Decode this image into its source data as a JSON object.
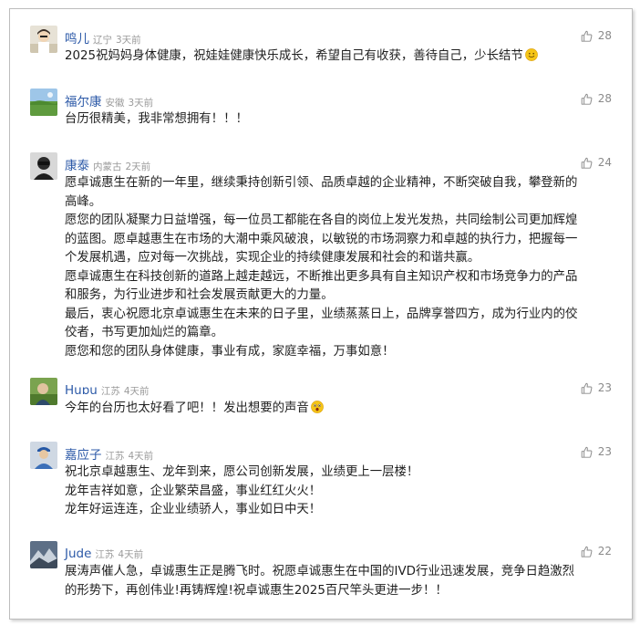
{
  "comments": [
    {
      "name": "鸣儿",
      "location": "辽宁",
      "time": "3天前",
      "likes": "28",
      "avatar": "avatar-person-light",
      "lines": [
        "2025祝妈妈身体健康，祝娃娃健康快乐成长，希望自己有收获，善待自己，少长结节"
      ],
      "emoji": "smiling-face-emoji"
    },
    {
      "name": "福尔康",
      "location": "安徽",
      "time": "3天前",
      "likes": "28",
      "avatar": "avatar-landscape",
      "lines": [
        "台历很精美，我非常想拥有！！！"
      ]
    },
    {
      "name": "康泰",
      "location": "内蒙古",
      "time": "2天前",
      "likes": "24",
      "avatar": "avatar-person-dark",
      "lines": [
        "愿卓诚惠生在新的一年里，继续秉持创新引领、品质卓越的企业精神，不断突破自我，攀登新的",
        "高峰。",
        "愿您的团队凝聚力日益增强，每一位员工都能在各自的岗位上发光发热，共同绘制公司更加辉煌",
        "的蓝图。愿卓越惠生在市场的大潮中乘风破浪，以敏锐的市场洞察力和卓越的执行力，把握每一",
        "个发展机遇，应对每一次挑战，实现企业的持续健康发展和社会的和谐共赢。",
        "愿卓诚惠生在科技创新的道路上越走越远，不断推出更多具有自主知识产权和市场竞争力的产品",
        "和服务，为行业进步和社会发展贡献更大的力量。",
        "最后，衷心祝愿北京卓诚惠生在未来的日子里，业绩蒸蒸日上，品牌享誉四方，成为行业内的佼",
        "佼者，书写更加灿烂的篇章。",
        "愿您和您的团队身体健康，事业有成，家庭幸福，万事如意！"
      ]
    },
    {
      "name": "Huɒu",
      "location": "江苏",
      "time": "4天前",
      "likes": "23",
      "avatar": "avatar-photo-green",
      "lines": [
        "今年的台历也太好看了吧！！发出想要的声音"
      ],
      "emoji": "surprised-face-emoji"
    },
    {
      "name": "嘉应子",
      "location": "江苏",
      "time": "4天前",
      "likes": "23",
      "avatar": "avatar-person-cap",
      "lines": [
        "祝北京卓越惠生、龙年到来，愿公司创新发展，业绩更上一层楼！",
        "龙年吉祥如意，企业繁荣昌盛，事业红红火火！",
        "龙年好运连连，企业业绩骄人，事业如日中天！"
      ]
    },
    {
      "name": "Jude",
      "location": "江苏",
      "time": "4天前",
      "likes": "22",
      "avatar": "avatar-mountain",
      "lines": [
        "展涛声催人急，卓诚惠生正是腾飞时。祝愿卓诚惠生在中国的IVD行业迅速发展，竞争日趋激烈",
        "的形势下，再创伟业!再铸辉煌!祝卓诚惠生2025百尺竿头更进一步！！"
      ]
    }
  ]
}
